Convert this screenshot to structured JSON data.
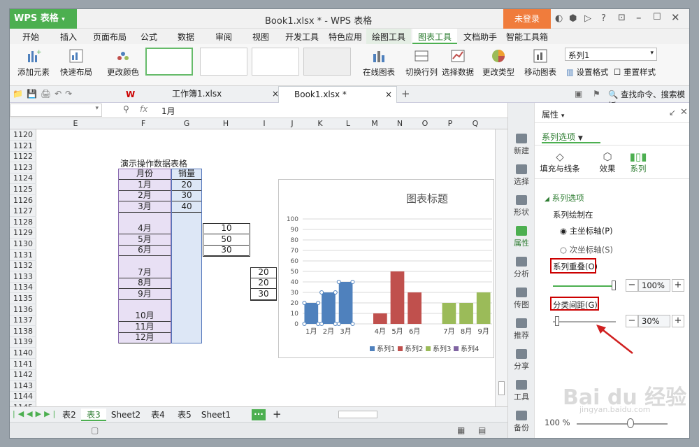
{
  "titlebar": {
    "app_label": "WPS 表格",
    "doc_title": "Book1.xlsx * - WPS 表格",
    "login_label": "未登录"
  },
  "menu": [
    "开始",
    "插入",
    "页面布局",
    "公式",
    "数据",
    "审阅",
    "视图",
    "开发工具",
    "特色应用",
    "绘图工具",
    "图表工具",
    "文档助手",
    "智能工具箱"
  ],
  "ribbon": {
    "add_element": "添加元素",
    "quick_layout": "快速布局",
    "change_color": "更改颜色",
    "online_chart": "在线图表",
    "switch_rowcol": "切换行列",
    "select_data": "选择数据",
    "change_type": "更改类型",
    "move_chart": "移动图表",
    "series_select": "系列1",
    "set_format": "设置格式",
    "reset_style": "重置样式"
  },
  "file_tabs": [
    {
      "label": "工作簿1.xlsx"
    },
    {
      "label": "Book1.xlsx *"
    }
  ],
  "search_label": "查找命令、搜索模板",
  "formula": {
    "namebox": "",
    "fx": "fx",
    "value": "1月"
  },
  "columns": [
    "E",
    "F",
    "G",
    "H",
    "I",
    "J",
    "K",
    "L",
    "M",
    "N",
    "O",
    "P",
    "Q"
  ],
  "rows": [
    "1120",
    "1121",
    "1122",
    "1123",
    "1124",
    "1125",
    "1126",
    "1127",
    "1128",
    "1129",
    "1130",
    "1131",
    "1132",
    "1133",
    "1134",
    "1135",
    "1136",
    "1137",
    "1138",
    "1139",
    "1140",
    "1141",
    "1142",
    "1143",
    "1144",
    "1145"
  ],
  "table": {
    "title": "演示操作数据表格",
    "header_month": "月份",
    "header_sales": "销量",
    "months": [
      "1月",
      "2月",
      "3月",
      "4月",
      "5月",
      "6月",
      "7月",
      "8月",
      "9月",
      "10月",
      "11月",
      "12月"
    ],
    "sales_g": [
      "20",
      "30",
      "40"
    ],
    "sales_h": [
      "10",
      "50",
      "30"
    ],
    "sales_i": [
      "20",
      "20",
      "30"
    ]
  },
  "chart_data": {
    "type": "bar",
    "title": "图表标题",
    "categories": [
      "1月",
      "2月",
      "3月",
      "",
      "4月",
      "5月",
      "6月",
      "",
      "7月",
      "8月",
      "9月"
    ],
    "series": [
      {
        "name": "系列1",
        "color": "#4f81bd",
        "values": [
          20,
          30,
          40,
          null,
          null,
          null,
          null,
          null,
          null,
          null,
          null
        ]
      },
      {
        "name": "系列2",
        "color": "#c0504d",
        "values": [
          null,
          null,
          null,
          null,
          10,
          50,
          30,
          null,
          null,
          null,
          null
        ]
      },
      {
        "name": "系列3",
        "color": "#9bbb59",
        "values": [
          null,
          null,
          null,
          null,
          null,
          null,
          null,
          null,
          20,
          20,
          30
        ]
      },
      {
        "name": "系列4",
        "color": "#8064a2",
        "values": [
          null,
          null,
          null,
          null,
          null,
          null,
          null,
          null,
          null,
          null,
          null
        ]
      }
    ],
    "ylim": [
      0,
      100
    ],
    "yticks": [
      0,
      10,
      20,
      30,
      40,
      50,
      60,
      70,
      80,
      90,
      100
    ],
    "grid": true,
    "legend": "bottom"
  },
  "sidebar": [
    "新建",
    "选择",
    "形状",
    "属性",
    "分析",
    "传图",
    "推荐",
    "分享",
    "工具",
    "备份"
  ],
  "panel": {
    "title": "属性",
    "dropdown": "系列选项",
    "tabs": [
      "填充与线条",
      "效果",
      "系列"
    ],
    "section": "系列选项",
    "plot_on_label": "系列绘制在",
    "primary_axis": "主坐标轴(P)",
    "secondary_axis": "次坐标轴(S)",
    "overlap_label": "系列重叠(O)",
    "overlap_value": "100%",
    "overlap_level": 1.0,
    "gap_label": "分类间距(G)",
    "gap_value": "30%",
    "gap_level": 0.04
  },
  "sheets": [
    "表2",
    "表3",
    "Sheet2",
    "表4",
    "表5",
    "Sheet1"
  ],
  "active_sheet": "表3",
  "zoom": "100 %",
  "watermark": "Bai du 经验 jingyan.baidu.com"
}
